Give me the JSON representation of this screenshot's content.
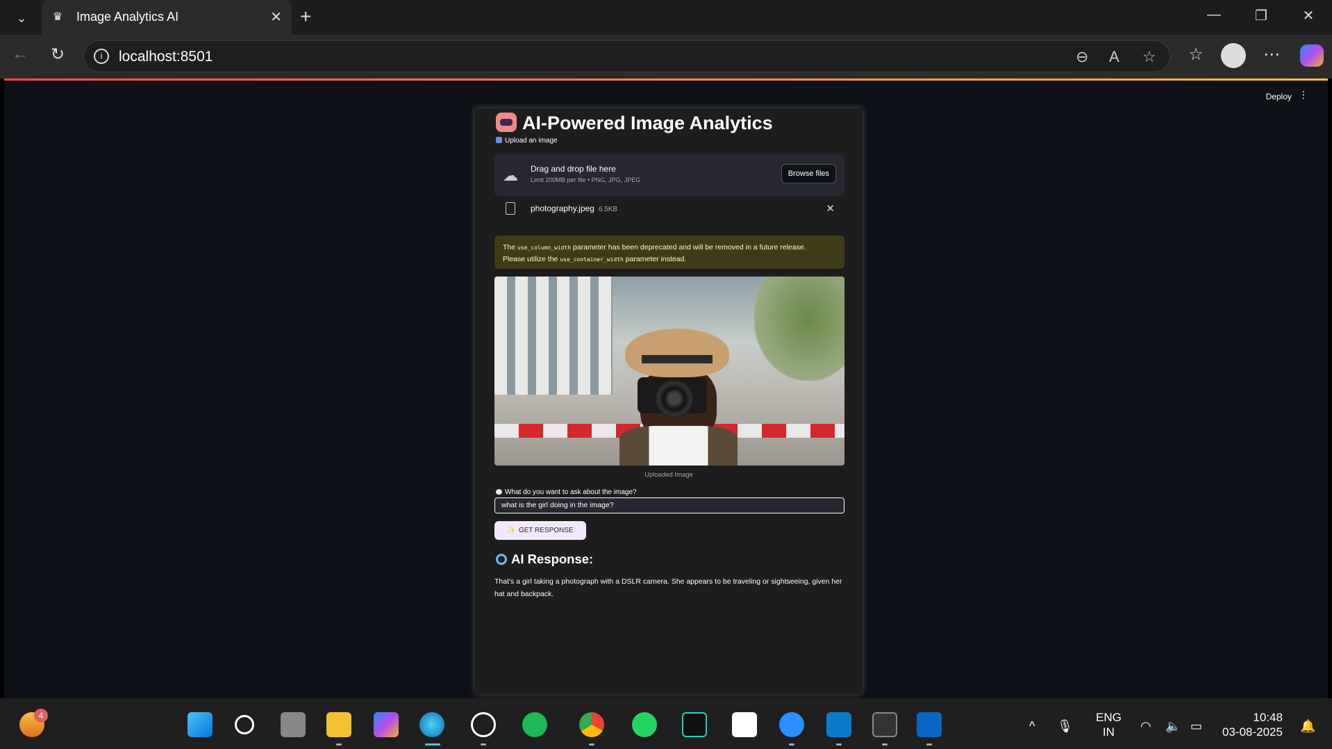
{
  "browser": {
    "tab_title": "Image Analytics AI",
    "url": "localhost:8501"
  },
  "streamlit": {
    "deploy_label": "Deploy",
    "kebab": "⋮"
  },
  "app": {
    "title": "AI-Powered Image Analytics",
    "upload_label": "Upload an image",
    "dropzone_title": "Drag and drop file here",
    "dropzone_sub": "Limit 200MB per file • PNG, JPG, JPEG",
    "browse_label": "Browse files",
    "file_name": "photography.jpeg",
    "file_size": "6.5KB",
    "warning_pre": "The ",
    "warning_code1": "use_column_width",
    "warning_mid": " parameter has been deprecated and will be removed in a future release.",
    "warning_line2_pre": "Please utilize the ",
    "warning_code2": "use_container_width",
    "warning_line2_post": " parameter instead.",
    "image_caption": "Uploaded Image",
    "question_label": "What do you want to ask about the image?",
    "question_value": "what is the girl doing in the image?",
    "button_label": "GET RESPONSE",
    "response_heading": "AI Response:",
    "response_text": "That's a girl taking a photograph with a DSLR camera. She appears to be traveling or sightseeing, given her hat and backpack."
  },
  "taskbar": {
    "notification_count": "4",
    "lang_line1": "ENG",
    "lang_line2": "IN",
    "time": "10:48",
    "date": "03-08-2025"
  },
  "colors": {
    "accent_warning_bg": "#3e3b16",
    "button_bg": "#f1e8fb",
    "app_bg": "#0e1117"
  }
}
